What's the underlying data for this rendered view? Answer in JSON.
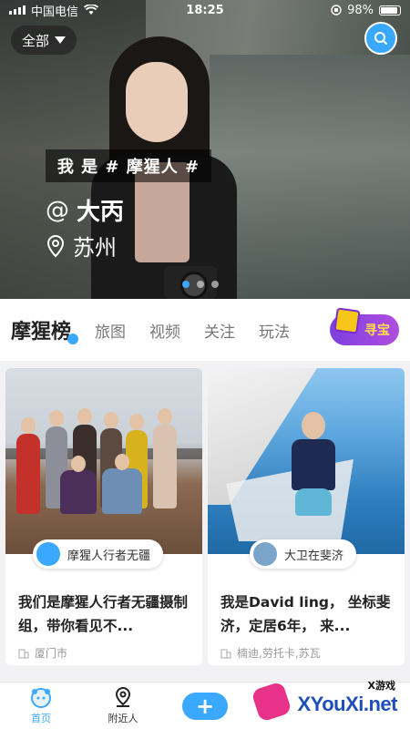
{
  "status_bar": {
    "carrier": "中国电信",
    "time": "18:25",
    "battery": "98%"
  },
  "hero": {
    "filter_label": "全部",
    "tag_line": "我 是 # 摩猩人 #",
    "author_prefix": "@",
    "author_name": "大丙",
    "location": "苏州",
    "slide_count": 3,
    "active_slide": 1
  },
  "tabs": {
    "main": "摩猩榜",
    "items": [
      "旅图",
      "视频",
      "关注",
      "玩法"
    ],
    "treasure_label": "寻宝"
  },
  "cards": [
    {
      "author": "摩猩人行者无疆",
      "title": "我们是摩猩人行者无疆摄制组，带你看见不...",
      "location": "厦门市"
    },
    {
      "author": "大卫在斐济",
      "title": "我是David ling， 坐标斐济，定居6年， 来...",
      "location": "楠迪,劳托卡,苏瓦"
    }
  ],
  "bottom_nav": {
    "home": "首页",
    "nearby": "附近人",
    "add": "+"
  },
  "watermark": {
    "top": "X游戏",
    "main": "XYouXi.net"
  },
  "colors": {
    "accent": "#3ba8ff",
    "treasure_bg": "#7d3fe0",
    "watermark": "#1e4fb8"
  },
  "icons": [
    "signal-icon",
    "wifi-icon",
    "battery-icon",
    "search-icon",
    "location-pin-icon",
    "building-icon",
    "home-icon",
    "nearby-pin-icon",
    "plus-icon"
  ]
}
